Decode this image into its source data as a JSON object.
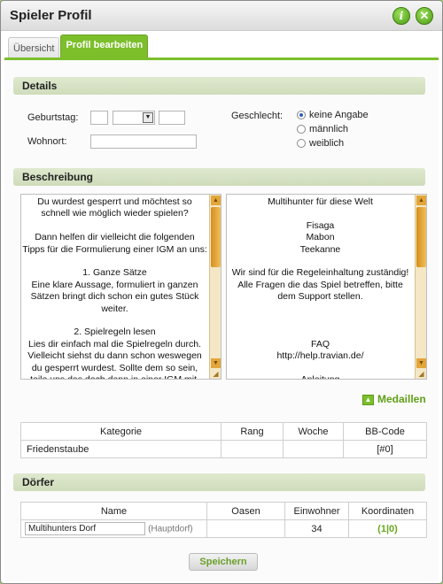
{
  "window": {
    "title": "Spieler Profil"
  },
  "tabs": [
    {
      "label": "Übersicht",
      "active": false
    },
    {
      "label": "Profil bearbeiten",
      "active": true
    }
  ],
  "details": {
    "header": "Details",
    "birthday_label": "Geburtstag:",
    "residence_label": "Wohnort:",
    "gender_label": "Geschlecht:",
    "gender_options": [
      {
        "label": "keine Angabe",
        "selected": true
      },
      {
        "label": "männlich",
        "selected": false
      },
      {
        "label": "weiblich",
        "selected": false
      }
    ]
  },
  "description": {
    "header": "Beschreibung",
    "left_text": "Du wurdest gesperrt und möchtest so\nschnell wie möglich wieder spielen?\n\nDann helfen dir vielleicht die folgenden\nTipps für die Formulierung einer IGM an uns:\n\n1. Ganze Sätze\nEine klare Aussage, formuliert in ganzen\nSätzen bringt dich schon ein gutes Stück\nweiter.\n\n2. Spielregeln lesen\nLies dir einfach mal die Spielregeln durch.\nVielleicht siehst du dann schon weswegen\ndu gesperrt wurdest. Sollte dem so sein,\nteile uns das doch dann in einer IGM mit.",
    "right_text": "Multihunter für diese Welt\n\nFisaga\nMabon\nTeekanne\n\nWir sind für die Regeleinhaltung zuständig!\nAlle Fragen die das Spiel betreffen, bitte\ndem Support stellen.\n\n\n\nFAQ\nhttp://help.travian.de/\n\nAnleitung"
  },
  "medals": {
    "link_label": "Medaillen",
    "columns": [
      "Kategorie",
      "Rang",
      "Woche",
      "BB-Code"
    ],
    "rows": [
      {
        "kategorie": "Friedenstaube",
        "rang": "",
        "woche": "",
        "bbcode": "[#0]"
      }
    ]
  },
  "villages": {
    "header": "Dörfer",
    "columns": [
      "Name",
      "Oasen",
      "Einwohner",
      "Koordinaten"
    ],
    "rows": [
      {
        "name": "Multihunters Dorf",
        "tag": "(Hauptdorf)",
        "oasen": "",
        "einwohner": "34",
        "koordinaten": "(1|0)"
      }
    ]
  },
  "save_label": "Speichern",
  "icons": {
    "info": "info-icon",
    "close": "close-icon",
    "medal": "medal-icon"
  },
  "colors": {
    "accent": "#7cbf2b",
    "link": "#61a018"
  }
}
